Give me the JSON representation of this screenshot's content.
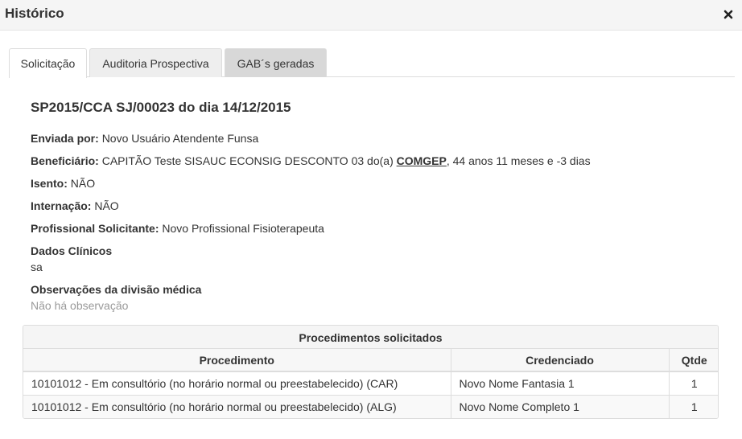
{
  "modal": {
    "title": "Histórico"
  },
  "tabs": [
    {
      "label": "Solicitação"
    },
    {
      "label": "Auditoria Prospectiva"
    },
    {
      "label": "GAB´s geradas"
    }
  ],
  "request": {
    "title": "SP2015/CCA SJ/00023 do dia 14/12/2015",
    "sent_by_label": "Enviada por:",
    "sent_by": "Novo Usuário Atendente Funsa",
    "beneficiary_label": "Beneficiário:",
    "beneficiary_prefix": "CAPITÃO Teste SISAUC ECONSIG DESCONTO 03 do(a)",
    "beneficiary_org": "COMGEP",
    "beneficiary_suffix": ", 44 anos 11 meses e -3 dias",
    "exempt_label": "Isento:",
    "exempt": "NÃO",
    "hospitalization_label": "Internação:",
    "hospitalization": "NÃO",
    "professional_label": "Profissional Solicitante:",
    "professional": "Novo Profissional Fisioterapeuta",
    "clinical_label": "Dados Clínicos",
    "clinical": "sa",
    "observations_label": "Observações da divisão médica",
    "observations": "Não há observação"
  },
  "procedures": {
    "heading": "Procedimentos solicitados",
    "columns": [
      "Procedimento",
      "Credenciado",
      "Qtde"
    ],
    "rows": [
      {
        "procedure": "10101012 - Em consultório (no horário normal ou preestabelecido) (CAR)",
        "provider": "Novo Nome Fantasia 1",
        "qty": "1"
      },
      {
        "procedure": "10101012 - Em consultório (no horário normal ou preestabelecido) (ALG)",
        "provider": "Novo Nome Completo 1",
        "qty": "1"
      }
    ]
  }
}
